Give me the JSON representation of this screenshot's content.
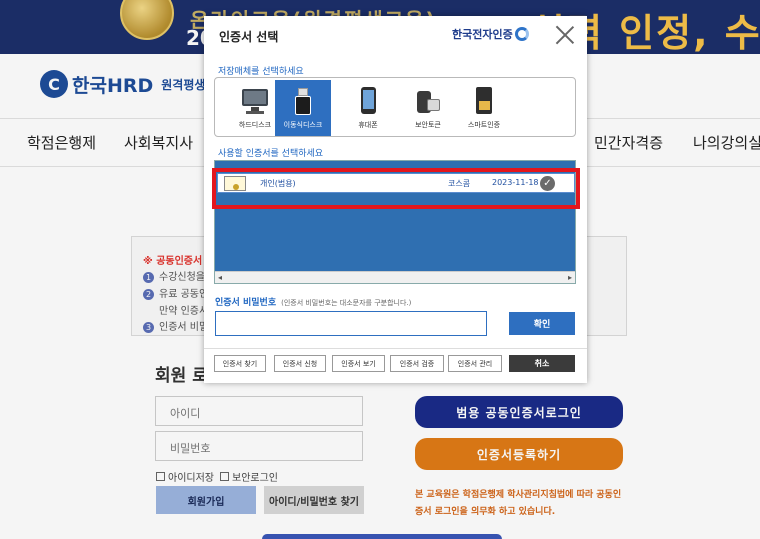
{
  "banner": {
    "text": "온라인교육(원격평생교육)",
    "year": "20",
    "big_text": "실력 인정, 수상!"
  },
  "site": {
    "logo_name": "한국HRD",
    "logo_sub": "원격평생교육원",
    "gnb": [
      "학점은행제",
      "사회복지사",
      "민간자격증",
      "나의강의실"
    ]
  },
  "notice": {
    "title": "※ 공동인증서 로",
    "lines": [
      "수강신청을 1",
      "유료 공동인",
      "만약 인증서",
      "인증서 비밀"
    ]
  },
  "login": {
    "title": "회원 로",
    "id_placeholder": "아이디",
    "pw_placeholder": "비밀번호",
    "save_id": "아이디저장",
    "secure_login": "보안로그인",
    "join": "회원가입",
    "find": "아이디/비밀번호 찾기",
    "cert_login": "범용 공동인증서로그인",
    "cert_register": "인증서등록하기",
    "law_line1": "본 교육원은 학점은행제 학사관리지침법에 따라 공동인",
    "law_line2": "증서 로그인을 의무화 하고 있습니다."
  },
  "modal": {
    "title": "인증서 선택",
    "brand": "한국전자인증",
    "storage_label": "저장매체를 선택하세요",
    "storage_items": [
      {
        "label": "하드디스크",
        "icon": "hard-disk-icon"
      },
      {
        "label": "이동식디스크",
        "icon": "usb-drive-icon"
      },
      {
        "label": "휴대폰",
        "icon": "mobile-phone-icon"
      },
      {
        "label": "보안토큰",
        "icon": "security-token-icon"
      },
      {
        "label": "스마트인증",
        "icon": "smart-cert-icon"
      }
    ],
    "selected_storage": "이동식디스크",
    "cert_label": "사용할 인증서를 선택하세요",
    "cert": {
      "name": "개인(범용)",
      "issuer": "코스콤",
      "expiry": "2023-11-18"
    },
    "pw_label": "인증서 비밀번호",
    "pw_note": "(인증서 비밀번호는 대소문자를 구분합니다.)",
    "ok": "확인",
    "footer_buttons": [
      "인증서 찾기",
      "인증서 신청",
      "인증서 보기",
      "인증서 검증",
      "인증서 관리"
    ],
    "cancel": "취소"
  },
  "colors": {
    "accent_blue": "#2e6fc0",
    "highlight_red": "#e3161d",
    "navy_button": "#1b2b8a",
    "orange_button": "#e07b16"
  }
}
